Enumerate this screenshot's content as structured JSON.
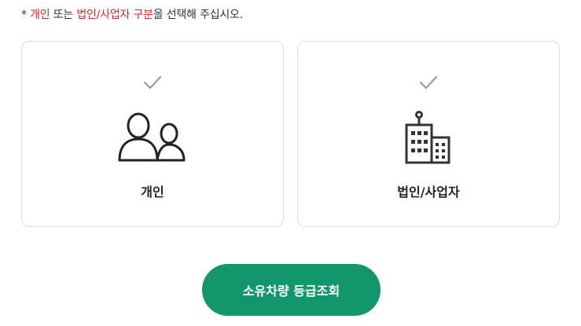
{
  "notice": {
    "prefix": "* ",
    "highlight1": "개인",
    "mid1": " 또는 ",
    "highlight2": "법인/사업자 구분",
    "suffix": "을 선택해 주십시오.",
    "accent_color": "#d7262d"
  },
  "options": [
    {
      "label": "개인",
      "icon": "people-icon",
      "check_icon": "check-icon"
    },
    {
      "label": "법인/사업자",
      "icon": "building-icon",
      "check_icon": "check-icon"
    }
  ],
  "cta": {
    "label": "소유차량 등급조회",
    "color": "#11976b"
  }
}
